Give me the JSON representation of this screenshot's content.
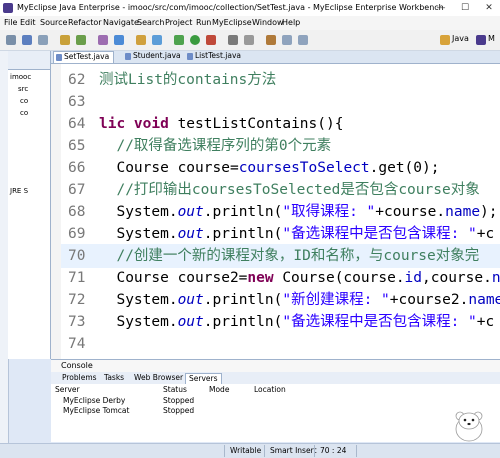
{
  "window": {
    "title": "MyEclipse Java Enterprise - imooc/src/com/imooc/collection/SetTest.java - MyEclipse Enterprise Workbench",
    "minimize": "—",
    "maximize": "☐",
    "close": "✕"
  },
  "menu": [
    "File",
    "Edit",
    "Source",
    "Refactor",
    "Navigate",
    "Search",
    "Project",
    "Run",
    "MyEclipse",
    "Window",
    "Help"
  ],
  "toolbar": {
    "perspective_java": "Java",
    "perspective_more": "M"
  },
  "package_explorer": {
    "items": [
      {
        "label": "imooc"
      },
      {
        "label": "src"
      },
      {
        "label": "co"
      },
      {
        "label": "co"
      },
      {
        "label": ""
      },
      {
        "label": ""
      },
      {
        "label": ""
      },
      {
        "label": ""
      },
      {
        "label": "JRE S"
      }
    ]
  },
  "editor_tabs": [
    {
      "label": "SetTest.java",
      "active": true
    },
    {
      "label": "Student.java",
      "active": false
    },
    {
      "label": "ListTest.java",
      "active": false
    }
  ],
  "code_lines": [
    {
      "n": "62",
      "segments": [
        {
          "t": "测试List的contains方法",
          "c": "cm"
        }
      ]
    },
    {
      "n": "63",
      "segments": []
    },
    {
      "n": "64",
      "segments": [
        {
          "t": "lic void ",
          "c": "kw"
        },
        {
          "t": "testListContains(){",
          "c": ""
        }
      ]
    },
    {
      "n": "65",
      "segments": [
        {
          "t": "  //取得备选课程序列的第0个元素",
          "c": "cm"
        }
      ]
    },
    {
      "n": "66",
      "segments": [
        {
          "t": "  Course course=",
          "c": ""
        },
        {
          "t": "coursesToSelect",
          "c": "fld"
        },
        {
          "t": ".get(0);",
          "c": ""
        }
      ]
    },
    {
      "n": "67",
      "segments": [
        {
          "t": "  //打印输出coursesToSelected是否包含course对象",
          "c": "cm"
        }
      ]
    },
    {
      "n": "68",
      "segments": [
        {
          "t": "  System.",
          "c": ""
        },
        {
          "t": "out",
          "c": "sfld"
        },
        {
          "t": ".println(",
          "c": ""
        },
        {
          "t": "\"取得课程: \"",
          "c": "st"
        },
        {
          "t": "+course.",
          "c": ""
        },
        {
          "t": "name",
          "c": "fld"
        },
        {
          "t": ");",
          "c": ""
        }
      ]
    },
    {
      "n": "69",
      "segments": [
        {
          "t": "  System.",
          "c": ""
        },
        {
          "t": "out",
          "c": "sfld"
        },
        {
          "t": ".println(",
          "c": ""
        },
        {
          "t": "\"备选课程中是否包含课程: \"",
          "c": "st"
        },
        {
          "t": "+c",
          "c": ""
        }
      ]
    },
    {
      "n": "70",
      "segments": [
        {
          "t": "  //创建一个新的课程对象，ID和名称，与course对象完",
          "c": "cm"
        }
      ],
      "highlight": true
    },
    {
      "n": "71",
      "segments": [
        {
          "t": "  Course course2=",
          "c": ""
        },
        {
          "t": "new ",
          "c": "kw"
        },
        {
          "t": "Course(course.",
          "c": ""
        },
        {
          "t": "id",
          "c": "fld"
        },
        {
          "t": ",course.",
          "c": ""
        },
        {
          "t": "na",
          "c": "fld"
        }
      ]
    },
    {
      "n": "72",
      "segments": [
        {
          "t": "  System.",
          "c": ""
        },
        {
          "t": "out",
          "c": "sfld"
        },
        {
          "t": ".println(",
          "c": ""
        },
        {
          "t": "\"新创建课程: \"",
          "c": "st"
        },
        {
          "t": "+course2.",
          "c": ""
        },
        {
          "t": "name",
          "c": "fld"
        }
      ]
    },
    {
      "n": "73",
      "segments": [
        {
          "t": "  System.",
          "c": ""
        },
        {
          "t": "out",
          "c": "sfld"
        },
        {
          "t": ".println(",
          "c": ""
        },
        {
          "t": "\"备选课程中是否包含课程: \"",
          "c": "st"
        },
        {
          "t": "+c",
          "c": ""
        }
      ]
    },
    {
      "n": "74",
      "segments": []
    },
    {
      "n": "75",
      "segments": []
    }
  ],
  "console": {
    "title": "Console"
  },
  "views_tabs": [
    "Problems",
    "Tasks",
    "Web Browser",
    "Servers"
  ],
  "servers_table": {
    "headers": [
      "Server",
      "Status",
      "Mode",
      "Location"
    ],
    "rows": [
      {
        "server": "MyEclipse Derby",
        "status": "Stopped"
      },
      {
        "server": "MyEclipse Tomcat",
        "status": "Stopped"
      }
    ]
  },
  "statusbar": {
    "writable": "Writable",
    "insert_mode": "Smart Insert",
    "position": "70 : 24"
  },
  "colors": {
    "comment": "#3f7f5f",
    "keyword": "#7f0055",
    "field": "#0000c0",
    "string": "#2a00ff"
  }
}
